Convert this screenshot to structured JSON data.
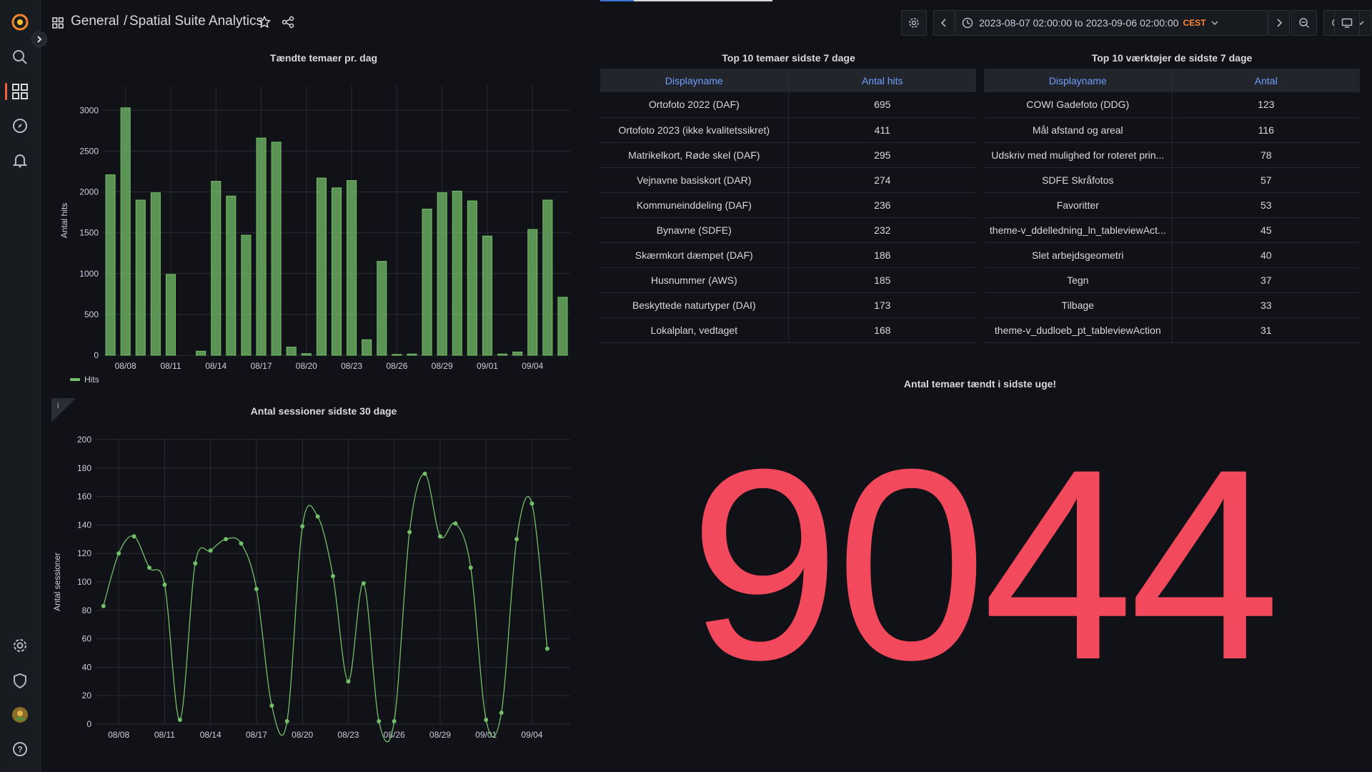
{
  "breadcrumb": {
    "folder": "General",
    "separator": "/",
    "dashboard": "Spatial Suite Analytics"
  },
  "time_range": {
    "label": "2023-08-07 02:00:00 to 2023-09-06 02:00:00",
    "timezone": "CEST"
  },
  "icons": {
    "sidebar": [
      "grafana-logo-icon",
      "search-icon",
      "dashboards-icon",
      "explore-icon",
      "alerting-icon",
      "settings-icon",
      "shield-icon",
      "user-avatar-icon",
      "help-icon"
    ],
    "topbar": [
      "dashboard-grid-icon",
      "star-icon",
      "share-icon",
      "settings-icon",
      "chevron-left-icon",
      "clock-icon",
      "chevron-down-icon",
      "chevron-right-icon",
      "zoom-out-icon",
      "refresh-icon",
      "chevron-down-icon",
      "tv-icon"
    ]
  },
  "colors": {
    "bar": "#73bf69",
    "stat": "#f2495c",
    "accent": "#f55f3e",
    "header_link": "#6e9fff"
  },
  "panels": {
    "bar_panel": {
      "title": "Tændte temaer pr. dag",
      "legend": "Hits"
    },
    "line_panel": {
      "title": "Antal sessioner sidste 30 dage"
    },
    "table_themes": {
      "title": "Top 10 temaer sidste 7 dage",
      "columns": [
        "Displayname",
        "Antal hits"
      ],
      "rows": [
        [
          "Ortofoto 2022 (DAF)",
          "695"
        ],
        [
          "Ortofoto 2023 (ikke kvalitetssikret)",
          "411"
        ],
        [
          "Matrikelkort, Røde skel (DAF)",
          "295"
        ],
        [
          "Vejnavne basiskort (DAR)",
          "274"
        ],
        [
          "Kommuneinddeling (DAF)",
          "236"
        ],
        [
          "Bynavne (SDFE)",
          "232"
        ],
        [
          "Skærmkort dæmpet (DAF)",
          "186"
        ],
        [
          "Husnummer (AWS)",
          "185"
        ],
        [
          "Beskyttede naturtyper (DAI)",
          "173"
        ],
        [
          "Lokalplan, vedtaget",
          "168"
        ]
      ]
    },
    "table_tools": {
      "title": "Top 10 værktøjer de sidste 7 dage",
      "columns": [
        "Displayname",
        "Antal"
      ],
      "rows": [
        [
          "COWI Gadefoto (DDG)",
          "123"
        ],
        [
          "Mål afstand og areal",
          "116"
        ],
        [
          "Udskriv med mulighed for roteret prin...",
          "78"
        ],
        [
          "SDFE Skråfotos",
          "57"
        ],
        [
          "Favoritter",
          "53"
        ],
        [
          "theme-v_ddelledning_ln_tableviewAct...",
          "45"
        ],
        [
          "Slet arbejdsgeometri",
          "40"
        ],
        [
          "Tegn",
          "37"
        ],
        [
          "Tilbage",
          "33"
        ],
        [
          "theme-v_dudloeb_pt_tableviewAction",
          "31"
        ]
      ]
    },
    "stat_panel": {
      "title": "Antal temaer tændt i sidste uge!",
      "value": "9044"
    }
  },
  "chart_data": [
    {
      "type": "bar",
      "title": "Tændte temaer pr. dag",
      "ylabel": "Antal hits",
      "xlabel": "",
      "ylim": [
        0,
        3300
      ],
      "yticks": [
        0,
        500,
        1000,
        1500,
        2000,
        2500,
        3000
      ],
      "xticks": [
        "08/08",
        "08/11",
        "08/14",
        "08/17",
        "08/20",
        "08/23",
        "08/26",
        "08/29",
        "09/01",
        "09/04"
      ],
      "x_start": "2023-08-07",
      "categories": [
        "08/07",
        "08/08",
        "08/09",
        "08/10",
        "08/11",
        "08/12",
        "08/13",
        "08/14",
        "08/15",
        "08/16",
        "08/17",
        "08/18",
        "08/19",
        "08/20",
        "08/21",
        "08/22",
        "08/23",
        "08/24",
        "08/25",
        "08/26",
        "08/27",
        "08/28",
        "08/29",
        "08/30",
        "08/31",
        "09/01",
        "09/02",
        "09/03",
        "09/04",
        "09/05",
        "09/06"
      ],
      "series": [
        {
          "name": "Hits",
          "values": [
            2210,
            3030,
            1900,
            1990,
            990,
            0,
            50,
            2130,
            1950,
            1470,
            2660,
            2610,
            100,
            20,
            2170,
            2050,
            2140,
            190,
            1150,
            10,
            15,
            1790,
            1990,
            2010,
            1890,
            1460,
            15,
            40,
            1540,
            1900,
            710
          ]
        }
      ],
      "legend": "bottom-left",
      "grid": true
    },
    {
      "type": "line",
      "title": "Antal sessioner sidste 30 dage",
      "ylabel": "Antal sessioner",
      "xlabel": "",
      "ylim": [
        0,
        200
      ],
      "yticks": [
        0,
        20,
        40,
        60,
        80,
        100,
        120,
        140,
        160,
        180,
        200
      ],
      "xticks": [
        "08/08",
        "08/11",
        "08/14",
        "08/17",
        "08/20",
        "08/23",
        "08/26",
        "08/29",
        "09/01",
        "09/04"
      ],
      "x": [
        "08/07",
        "08/08",
        "08/09",
        "08/10",
        "08/11",
        "08/12",
        "08/13",
        "08/14",
        "08/15",
        "08/16",
        "08/17",
        "08/18",
        "08/19",
        "08/20",
        "08/21",
        "08/22",
        "08/23",
        "08/24",
        "08/25",
        "08/26",
        "08/27",
        "08/28",
        "08/29",
        "08/30",
        "08/31",
        "09/01",
        "09/02",
        "09/03",
        "09/04",
        "09/05",
        "09/06"
      ],
      "series": [
        {
          "values": [
            83,
            120,
            132,
            110,
            98,
            3,
            113,
            122,
            130,
            127,
            95,
            13,
            2,
            139,
            146,
            104,
            30,
            99,
            2,
            2,
            135,
            176,
            132,
            141,
            110,
            3,
            8,
            130,
            155,
            53,
            null
          ]
        }
      ],
      "grid": true
    }
  ]
}
